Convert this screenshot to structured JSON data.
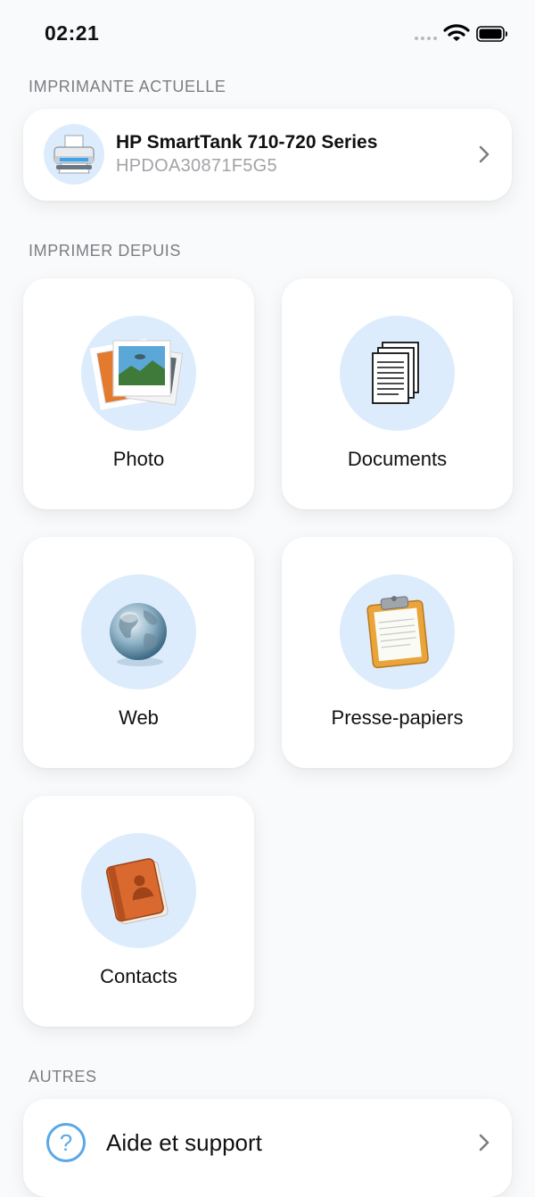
{
  "status_bar": {
    "time": "02:21"
  },
  "current_printer": {
    "section_label": "IMPRIMANTE ACTUELLE",
    "name": "HP SmartTank 710-720 Series",
    "serial": "HPDOA30871F5G5"
  },
  "print_from": {
    "section_label": "IMPRIMER DEPUIS",
    "tiles": [
      {
        "label": "Photo",
        "icon": "photo-icon"
      },
      {
        "label": "Documents",
        "icon": "documents-icon"
      },
      {
        "label": "Web",
        "icon": "globe-icon"
      },
      {
        "label": "Presse-papiers",
        "icon": "clipboard-icon"
      },
      {
        "label": "Contacts",
        "icon": "address-book-icon"
      }
    ]
  },
  "others": {
    "section_label": "AUTRES",
    "items": [
      {
        "label": "Aide et support",
        "icon": "help-icon"
      }
    ]
  },
  "colors": {
    "accent_circle": "#dcecfc",
    "background": "#f9fafb",
    "help_blue": "#5aa8e6"
  }
}
